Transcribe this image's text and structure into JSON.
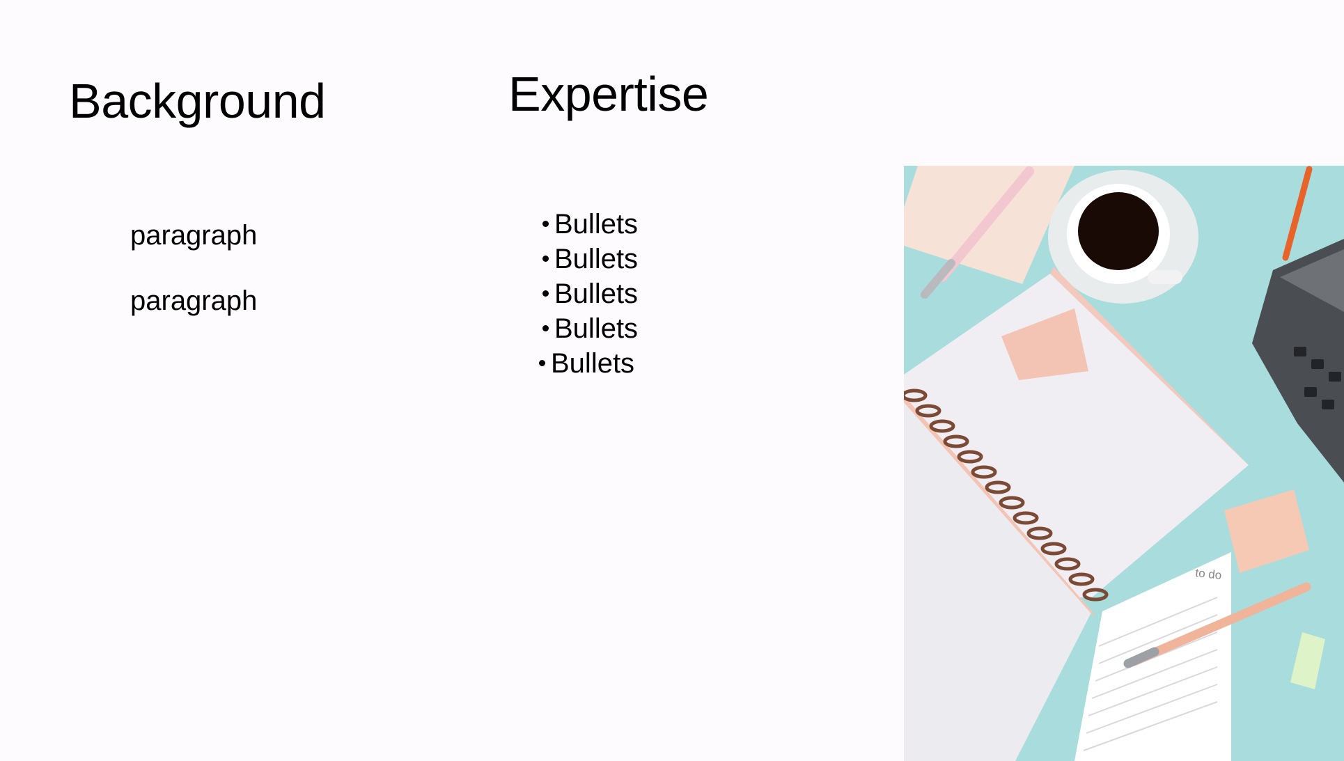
{
  "slide": {
    "left_heading": "Background",
    "center_heading": "Expertise",
    "paragraphs": [
      "paragraph",
      "paragraph"
    ],
    "bullets": [
      "Bullets",
      "Bullets",
      "Bullets",
      "Bullets",
      "Bullets"
    ],
    "photo": {
      "subject": "desk-flatlay-photo",
      "note_text": "to do",
      "colors": {
        "background": "#a8dcdd",
        "notebook": "#f5f4f7",
        "sticky": "#f3c3b3",
        "coffee": "#1a0a06"
      }
    }
  }
}
